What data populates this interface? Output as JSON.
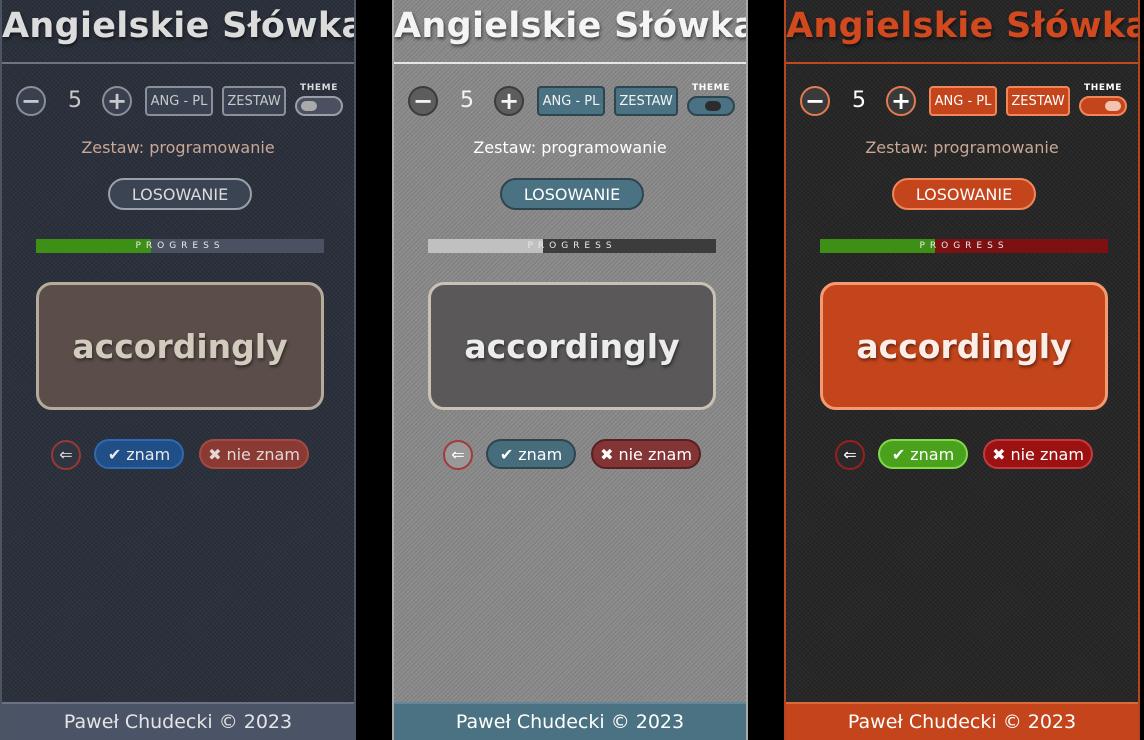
{
  "app": {
    "title": "Angielskie Słówka",
    "count": "5",
    "direction_label": "ANG - PL",
    "set_button_label": "ZESTAW",
    "theme_label": "THEME",
    "current_set_text": "Zestaw: programowanie",
    "draw_button_label": "LOSOWANIE",
    "progress_label": "PROGRESS",
    "progress_value": 0.4,
    "word": "accordingly",
    "back_icon": "arrow-left-icon",
    "know_label": "znam",
    "know_icon": "check-icon",
    "dont_know_label": "nie znam",
    "dont_know_icon": "x-icon",
    "footer": "Paweł Chudecki © 2023"
  },
  "themes": [
    {
      "name": "dark",
      "accent": "#2a303b",
      "footer_bg": "#4b5466",
      "card_bg": "#5b4e4a",
      "title_color": "#dcdcdc"
    },
    {
      "name": "grey",
      "accent": "#4b7282",
      "footer_bg": "#4b7282",
      "card_bg": "#5a5858",
      "title_color": "#f4f4f4"
    },
    {
      "name": "orange",
      "accent": "#c4451c",
      "footer_bg": "#c4451c",
      "card_bg": "#c4451c",
      "title_color": "#d0491f"
    }
  ]
}
